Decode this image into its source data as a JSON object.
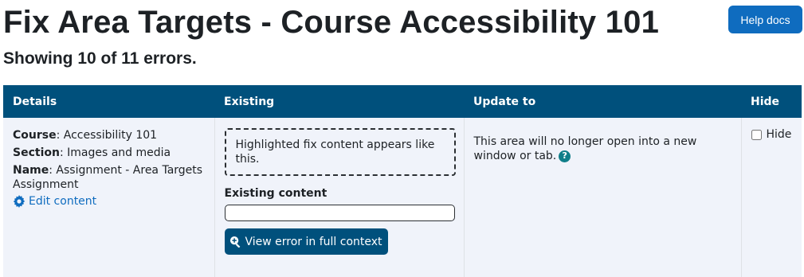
{
  "header": {
    "title": "Fix Area Targets - Course Accessibility 101",
    "help_button": "Help docs",
    "summary": "Showing 10 of 11 errors."
  },
  "table": {
    "columns": {
      "details": "Details",
      "existing": "Existing",
      "update": "Update to",
      "hide": "Hide"
    },
    "row": {
      "course_label": "Course",
      "course_value": ": Accessibility 101",
      "section_label": "Section",
      "section_value": ": Images and media",
      "name_label": "Name",
      "name_value": ": Assignment - Area Targets Assignment",
      "edit_link": "Edit content",
      "fix_preview": "Highlighted fix content appears like this.",
      "existing_content_label": "Existing content",
      "existing_content_value": "",
      "view_button": "View error in full context",
      "update_text": "This area will no longer open into a new window or tab.",
      "help_icon_glyph": "?",
      "hide_label": "Hide",
      "hide_checked": false
    }
  },
  "colors": {
    "header_bg": "#00507c",
    "accent": "#0f6cbf",
    "row_bg": "#f0f3fa"
  },
  "icons": [
    "gear-icon",
    "magnify-plus-icon",
    "help-icon"
  ]
}
